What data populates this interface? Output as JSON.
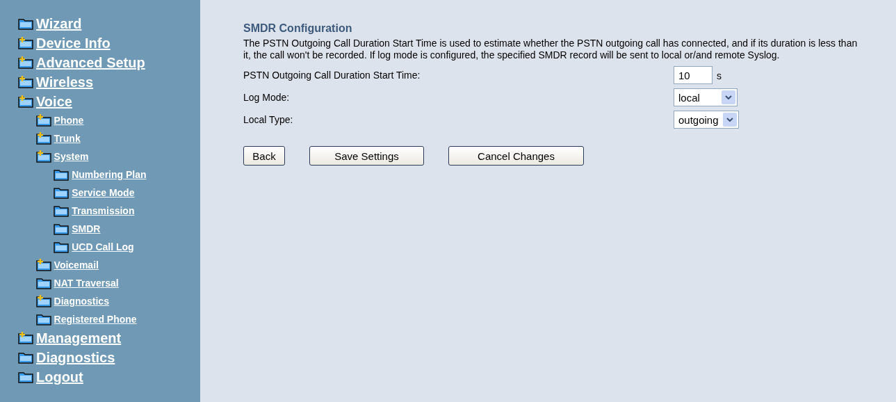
{
  "sidebar": {
    "items": [
      {
        "label": "Wizard",
        "kind": "folder"
      },
      {
        "label": "Device Info",
        "kind": "folder-plus"
      },
      {
        "label": "Advanced Setup",
        "kind": "folder-plus"
      },
      {
        "label": "Wireless",
        "kind": "folder-plus"
      },
      {
        "label": "Voice",
        "kind": "folder-plus",
        "children": [
          {
            "label": "Phone",
            "kind": "folder-plus"
          },
          {
            "label": "Trunk",
            "kind": "folder-plus"
          },
          {
            "label": "System",
            "kind": "folder-plus",
            "children": [
              {
                "label": "Numbering Plan",
                "kind": "folder"
              },
              {
                "label": "Service Mode",
                "kind": "folder"
              },
              {
                "label": "Transmission",
                "kind": "folder"
              },
              {
                "label": "SMDR",
                "kind": "folder"
              },
              {
                "label": "UCD Call Log",
                "kind": "folder"
              }
            ]
          },
          {
            "label": "Voicemail",
            "kind": "folder-plus"
          },
          {
            "label": "NAT Traversal",
            "kind": "folder"
          },
          {
            "label": "Diagnostics",
            "kind": "folder-plus"
          },
          {
            "label": "Registered Phone",
            "kind": "folder"
          }
        ]
      },
      {
        "label": "Management",
        "kind": "folder-plus"
      },
      {
        "label": "Diagnostics",
        "kind": "folder"
      },
      {
        "label": "Logout",
        "kind": "folder"
      }
    ]
  },
  "main": {
    "title": "SMDR Configuration",
    "description": "The PSTN Outgoing Call Duration Start Time is used to estimate whether the PSTN outgoing call has connected, and if its duration is less than it, the call won't be recorded. If log mode is configured, the specified SMDR record will be sent to local or/and remote Syslog.",
    "fields": [
      {
        "label": "PSTN Outgoing Call Duration Start Time:",
        "kind": "input",
        "value": "10",
        "unit": "s"
      },
      {
        "label": "Log Mode:",
        "kind": "select",
        "value": "local"
      },
      {
        "label": "Local Type:",
        "kind": "select",
        "value": "outgoing"
      }
    ],
    "buttons": [
      "Back",
      "Save Settings",
      "Cancel Changes"
    ]
  }
}
